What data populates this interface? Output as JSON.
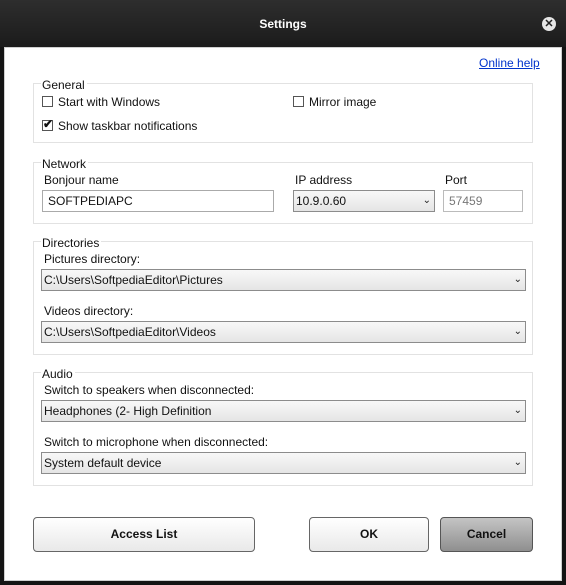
{
  "window": {
    "title": "Settings",
    "close_icon": "close-icon"
  },
  "online_help": "Online help",
  "general": {
    "legend": "General",
    "start_with_windows": {
      "label": "Start with Windows",
      "checked": false
    },
    "mirror_image": {
      "label": "Mirror image",
      "checked": false
    },
    "show_taskbar": {
      "label": "Show taskbar notifications",
      "checked": true
    }
  },
  "network": {
    "legend": "Network",
    "bonjour_label": "Bonjour name",
    "bonjour_value": "SOFTPEDIAPC",
    "ip_label": "IP address",
    "ip_value": "10.9.0.60",
    "port_label": "Port",
    "port_value": "57459"
  },
  "directories": {
    "legend": "Directories",
    "pictures_label": "Pictures directory:",
    "pictures_value": "C:\\Users\\SoftpediaEditor\\Pictures",
    "videos_label": "Videos directory:",
    "videos_value": "C:\\Users\\SoftpediaEditor\\Videos"
  },
  "audio": {
    "legend": "Audio",
    "speakers_label": "Switch to speakers when disconnected:",
    "speakers_value": "Headphones (2- High Definition",
    "microphone_label": "Switch to microphone when disconnected:",
    "microphone_value": "System default device"
  },
  "buttons": {
    "access_list": "Access List",
    "ok": "OK",
    "cancel": "Cancel"
  },
  "checkmark": "✔",
  "dropdown_arrow": "⌄"
}
